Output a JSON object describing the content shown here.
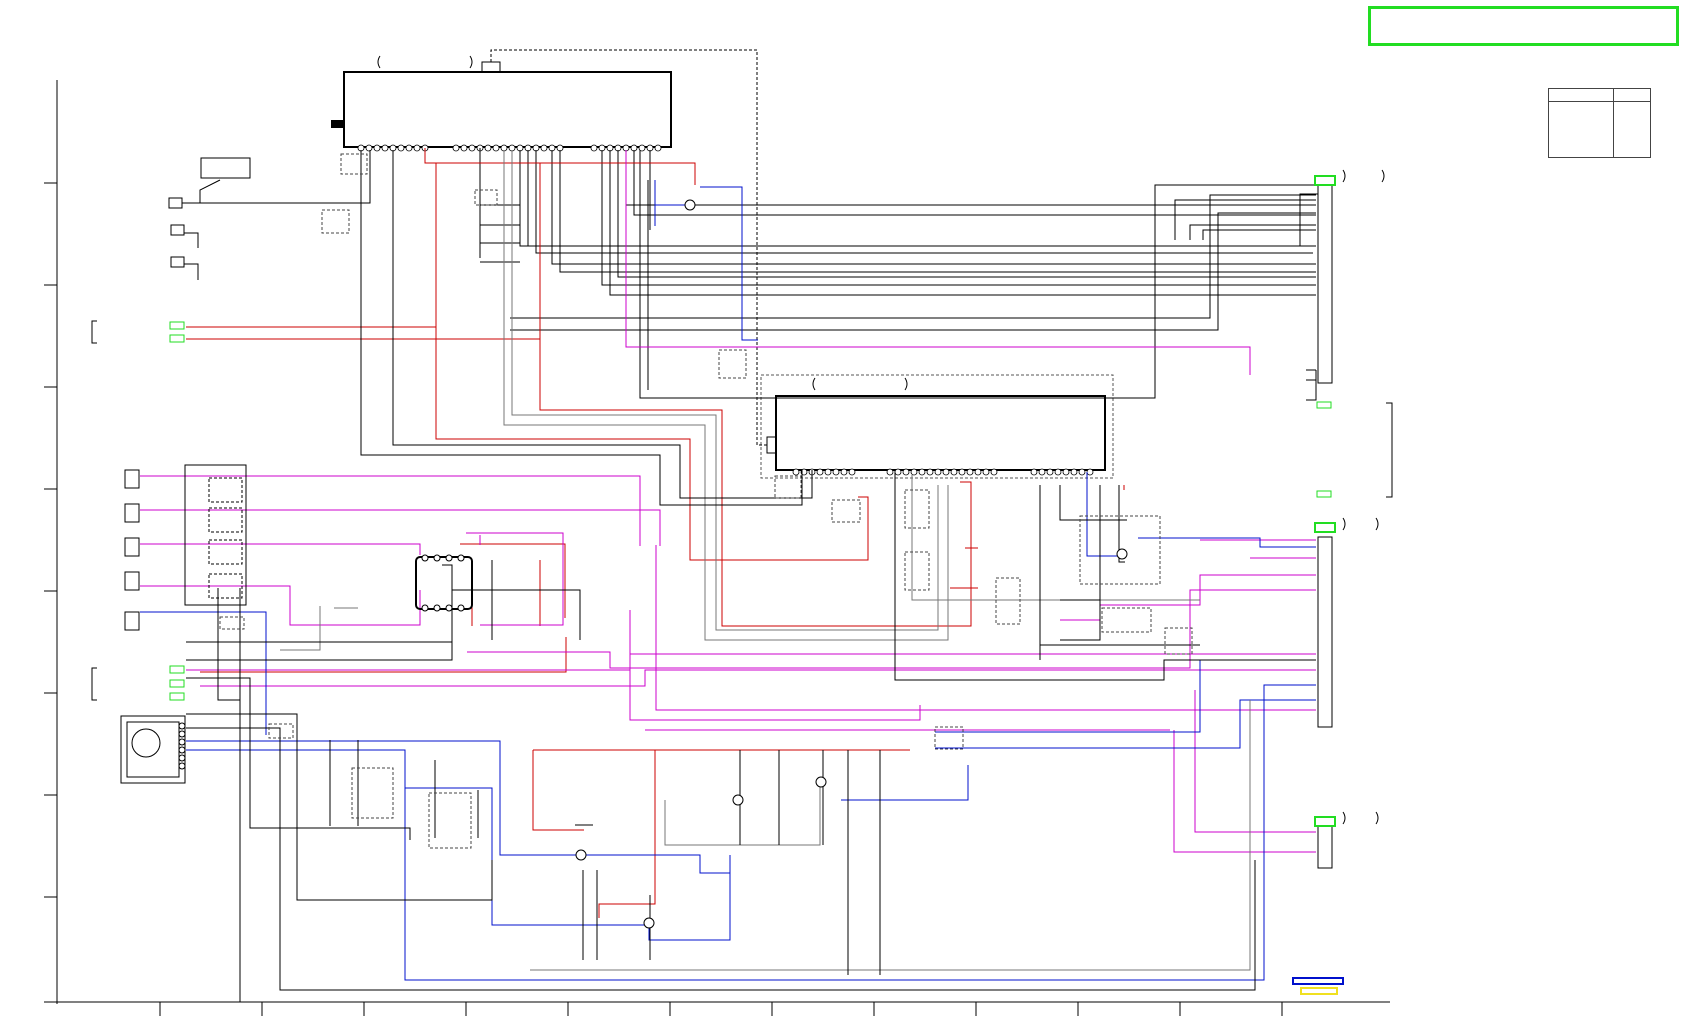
{
  "document": {
    "title": "",
    "legend_colors": {
      "signal_positive": "#cc0000",
      "video": "#0010cc",
      "audio": "#cc00cc",
      "ground": "#000000",
      "connector": "#22dd22",
      "option": "#f0e020"
    }
  },
  "connectors": [
    {
      "id": "cn-top-right",
      "name": ""
    },
    {
      "id": "cn-mid-right",
      "name": ""
    },
    {
      "id": "cn-bottom-right",
      "name": ""
    }
  ],
  "ics": [
    {
      "id": "ic-upper",
      "label": ""
    },
    {
      "id": "ic-lower",
      "label": ""
    }
  ],
  "info_table": {
    "header_left": "",
    "header_right": ""
  }
}
